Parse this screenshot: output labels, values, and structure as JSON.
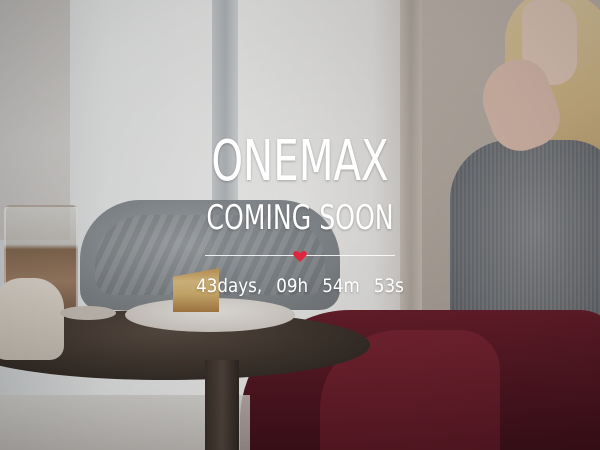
{
  "hero": {
    "brand": "ONEMAX",
    "tagline": "COMING SOON"
  },
  "divider": {
    "icon": "heart-icon",
    "color": "#e0263f"
  },
  "countdown": {
    "days_value": "43",
    "days_label": "days,",
    "hours_value": "09",
    "hours_label": "h",
    "minutes_value": "54",
    "minutes_label": "m",
    "seconds_value": "53",
    "seconds_label": "s"
  }
}
